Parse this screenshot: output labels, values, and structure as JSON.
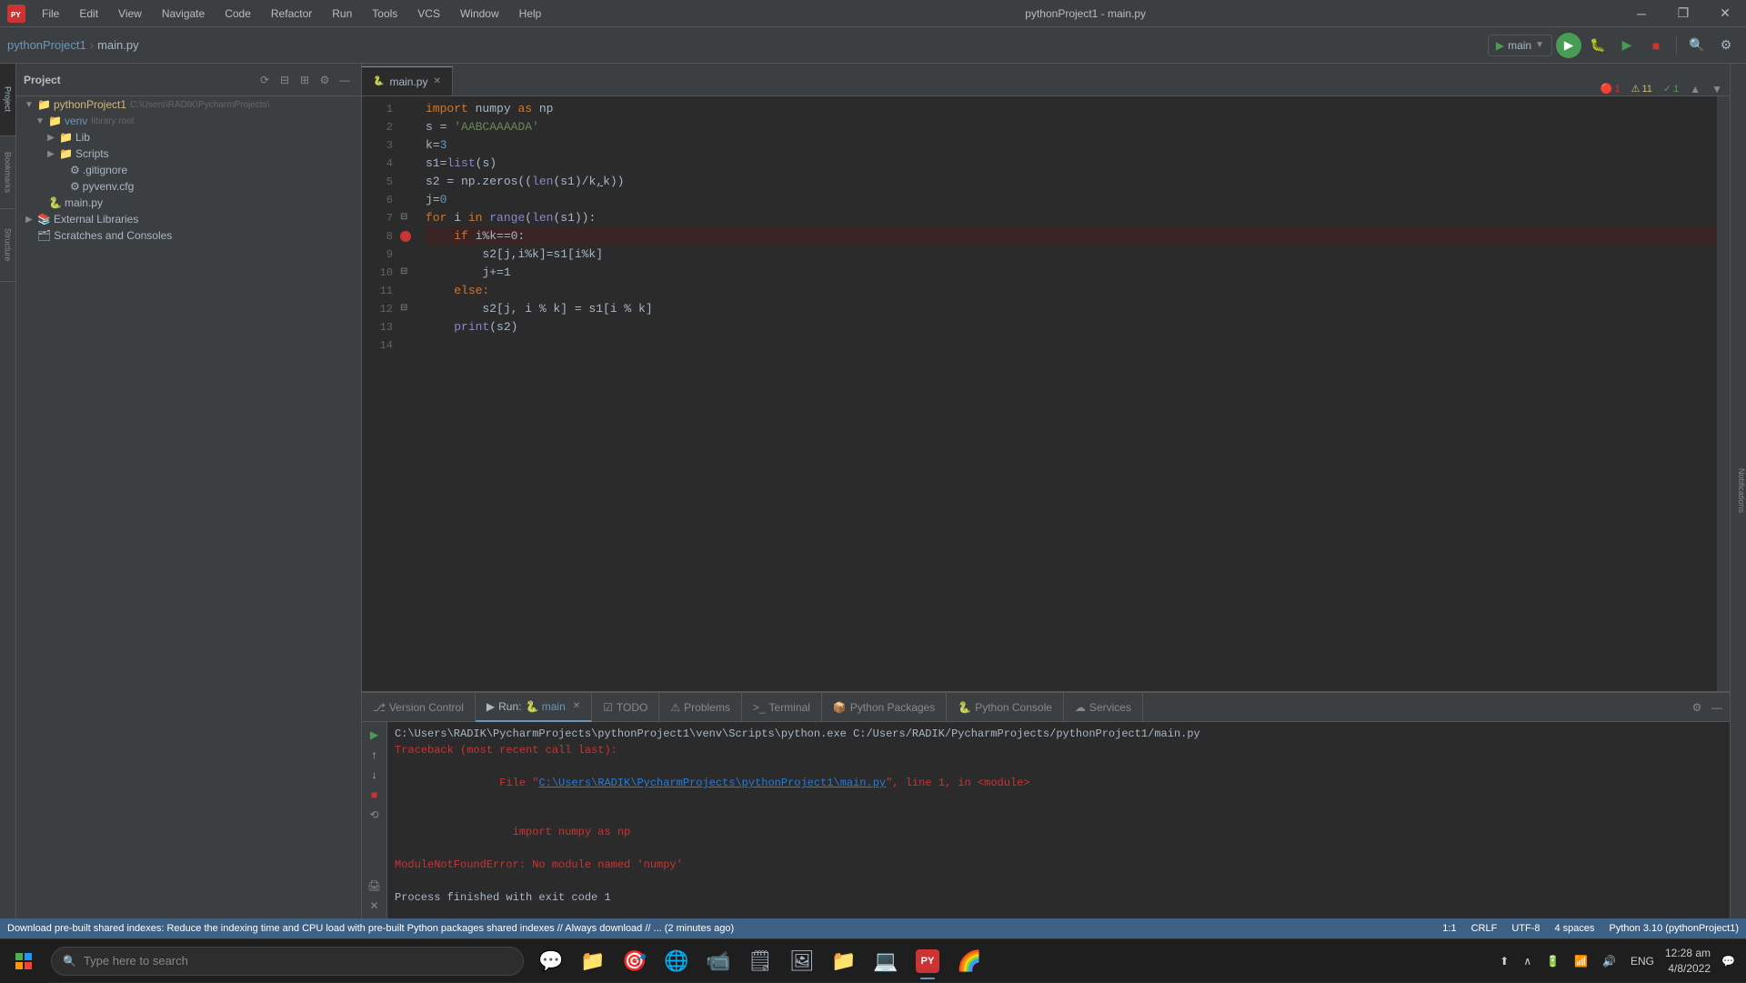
{
  "app": {
    "title": "pythonProject1 - main.py",
    "logo": "PY"
  },
  "menu": {
    "items": [
      "File",
      "Edit",
      "View",
      "Navigate",
      "Code",
      "Refactor",
      "Run",
      "Tools",
      "VCS",
      "Window",
      "Help"
    ]
  },
  "titlebar": {
    "controls": [
      "—",
      "❐",
      "✕"
    ]
  },
  "toolbar": {
    "breadcrumb_project": "pythonProject1",
    "breadcrumb_file": "main.py",
    "run_config": "main",
    "search_icon": "🔍",
    "settings_icon": "⚙"
  },
  "project_panel": {
    "title": "Project",
    "root": {
      "name": "pythonProject1",
      "path": "C:\\Users\\RADIK\\PycharmProjects\\"
    },
    "tree": [
      {
        "indent": 0,
        "type": "folder",
        "expanded": true,
        "name": "pythonProject1",
        "path": "C:\\Users\\RADIK\\PycharmProjects\\",
        "color": "yellow"
      },
      {
        "indent": 1,
        "type": "folder",
        "expanded": true,
        "name": "venv",
        "suffix": "library root",
        "color": "blue"
      },
      {
        "indent": 2,
        "type": "folder",
        "expanded": false,
        "name": "Lib",
        "color": "normal"
      },
      {
        "indent": 2,
        "type": "folder",
        "expanded": false,
        "name": "Scripts",
        "color": "normal"
      },
      {
        "indent": 2,
        "type": "file",
        "name": ".gitignore",
        "icon": "⚙",
        "color": "normal"
      },
      {
        "indent": 2,
        "type": "file",
        "name": "pyvenv.cfg",
        "icon": "⚙",
        "color": "normal"
      },
      {
        "indent": 1,
        "type": "file",
        "name": "main.py",
        "icon": "🐍",
        "color": "normal"
      },
      {
        "indent": 1,
        "type": "folder",
        "expanded": false,
        "name": "External Libraries",
        "color": "normal"
      },
      {
        "indent": 1,
        "type": "item",
        "name": "Scratches and Consoles",
        "icon": "🗂",
        "color": "normal"
      }
    ]
  },
  "editor": {
    "tab": "main.py",
    "error_count": 1,
    "warn_count": 11,
    "ok_count": 1,
    "lines": [
      {
        "num": 1,
        "tokens": [
          {
            "t": "import ",
            "c": "kw"
          },
          {
            "t": "numpy",
            "c": "module"
          },
          {
            "t": " as ",
            "c": "plain"
          },
          {
            "t": "np",
            "c": "plain"
          }
        ]
      },
      {
        "num": 2,
        "tokens": [
          {
            "t": "s",
            "c": "plain"
          },
          {
            "t": " = ",
            "c": "plain"
          },
          {
            "t": "'AABCAAAADA'",
            "c": "str"
          }
        ]
      },
      {
        "num": 3,
        "tokens": [
          {
            "t": "k",
            "c": "plain"
          },
          {
            "t": "=",
            "c": "plain"
          },
          {
            "t": "3",
            "c": "num"
          }
        ]
      },
      {
        "num": 4,
        "tokens": [
          {
            "t": "s1",
            "c": "plain"
          },
          {
            "t": "=",
            "c": "plain"
          },
          {
            "t": "list",
            "c": "builtin"
          },
          {
            "t": "(s)",
            "c": "plain"
          }
        ]
      },
      {
        "num": 5,
        "tokens": [
          {
            "t": "s2 = np.zeros((",
            "c": "plain"
          },
          {
            "t": "len",
            "c": "builtin"
          },
          {
            "t": "(s1)/k",
            "c": "plain"
          },
          {
            "t": ",",
            "c": "plain"
          },
          {
            "t": "k))",
            "c": "plain"
          }
        ]
      },
      {
        "num": 6,
        "tokens": [
          {
            "t": "j",
            "c": "plain"
          },
          {
            "t": "=",
            "c": "plain"
          },
          {
            "t": "0",
            "c": "num"
          }
        ]
      },
      {
        "num": 7,
        "tokens": [
          {
            "t": "for ",
            "c": "kw"
          },
          {
            "t": "i ",
            "c": "plain"
          },
          {
            "t": "in ",
            "c": "kw"
          },
          {
            "t": "range",
            "c": "builtin"
          },
          {
            "t": "(",
            "c": "plain"
          },
          {
            "t": "len",
            "c": "builtin"
          },
          {
            "t": "(s1)):",
            "c": "plain"
          }
        ]
      },
      {
        "num": 8,
        "tokens": [
          {
            "t": "    ",
            "c": "plain"
          },
          {
            "t": "if ",
            "c": "kw"
          },
          {
            "t": "i%k==0:",
            "c": "plain"
          }
        ],
        "breakpoint": true,
        "highlighted": true
      },
      {
        "num": 9,
        "tokens": [
          {
            "t": "        s2[j,i%k]=s1[i%k]",
            "c": "plain"
          }
        ]
      },
      {
        "num": 10,
        "tokens": [
          {
            "t": "        j+=1",
            "c": "plain"
          }
        ]
      },
      {
        "num": 11,
        "tokens": [
          {
            "t": "    ",
            "c": "plain"
          },
          {
            "t": "else:",
            "c": "kw"
          }
        ]
      },
      {
        "num": 12,
        "tokens": [
          {
            "t": "        s2[j, i % k] = s1[i % k]",
            "c": "plain"
          }
        ]
      },
      {
        "num": 13,
        "tokens": [
          {
            "t": "    ",
            "c": "plain"
          },
          {
            "t": "print",
            "c": "builtin"
          },
          {
            "t": "(s2)",
            "c": "plain"
          }
        ]
      },
      {
        "num": 14,
        "tokens": [
          {
            "t": "",
            "c": "plain"
          }
        ]
      }
    ]
  },
  "run_panel": {
    "tab": "main",
    "cmd_line": "C:\\Users\\RADIK\\PycharmProjects\\pythonProject1\\venv\\Scripts\\python.exe C:/Users/RADIK/PycharmProjects/pythonProject1/main.py",
    "line2": "Traceback (most recent call last):",
    "line3_prefix": "  File \"",
    "line3_link": "C:\\Users\\RADIK\\PycharmProjects\\pythonProject1\\main.py",
    "line3_suffix": "\", line 1, in <module>",
    "line4": "    import numpy as np",
    "line5": "ModuleNotFoundError: No module named 'numpy'",
    "line6": "",
    "line7": "Process finished with exit code 1"
  },
  "bottom_tabs": [
    {
      "label": "Version Control",
      "icon": "⎇",
      "active": false
    },
    {
      "label": "Run",
      "icon": "▶",
      "active": true
    },
    {
      "label": "TODO",
      "icon": "☑",
      "active": false
    },
    {
      "label": "Problems",
      "icon": "⚠",
      "active": false
    },
    {
      "label": "Terminal",
      "icon": ">_",
      "active": false
    },
    {
      "label": "Python Packages",
      "icon": "📦",
      "active": false
    },
    {
      "label": "Python Console",
      "icon": "🐍",
      "active": false
    },
    {
      "label": "Services",
      "icon": "☁",
      "active": false
    }
  ],
  "status_bar": {
    "left": "Download pre-built shared indexes: Reduce the indexing time and CPU load with pre-built Python packages shared indexes // Always download // ... (2 minutes ago)",
    "position": "1:1",
    "line_sep": "CRLF",
    "encoding": "UTF-8",
    "indent": "4 spaces",
    "python_version": "Python 3.10 (pythonProject1)"
  },
  "taskbar": {
    "search_placeholder": "Type here to search",
    "apps": [
      "🪟",
      "💬",
      "📁",
      "🎯",
      "🌐",
      "📹",
      "🗒",
      "🖼",
      "📁",
      "💻",
      "💎",
      "🌈"
    ],
    "time": "12:28 am",
    "date": "4/8/2022",
    "lang": "ENG"
  },
  "left_vertical_panels": [
    {
      "label": "Project",
      "active": true
    },
    {
      "label": "Bookmarks"
    },
    {
      "label": "Structure"
    }
  ]
}
